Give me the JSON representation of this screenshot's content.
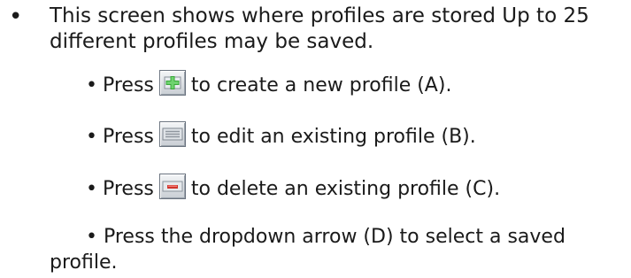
{
  "main_bullet": {
    "marker": "•",
    "text": "This screen shows where profiles are stored Up to 25 different profiles may be saved."
  },
  "sub_items": [
    {
      "marker": "•",
      "press": "Press",
      "icon": "add-profile-icon",
      "text": "to create a new profile (A)."
    },
    {
      "marker": "•",
      "press": "Press",
      "icon": "edit-profile-icon",
      "text": "to edit an existing profile (B)."
    },
    {
      "marker": "•",
      "press": "Press",
      "icon": "delete-profile-icon",
      "text": "to delete an existing profile (C)."
    }
  ],
  "last_item": {
    "marker": "•",
    "text": "Press the dropdown arrow (D) to select a saved profile."
  },
  "colors": {
    "text": "#1a1a1a",
    "icon_plus": "#3aa83a",
    "icon_minus": "#d0342c"
  }
}
